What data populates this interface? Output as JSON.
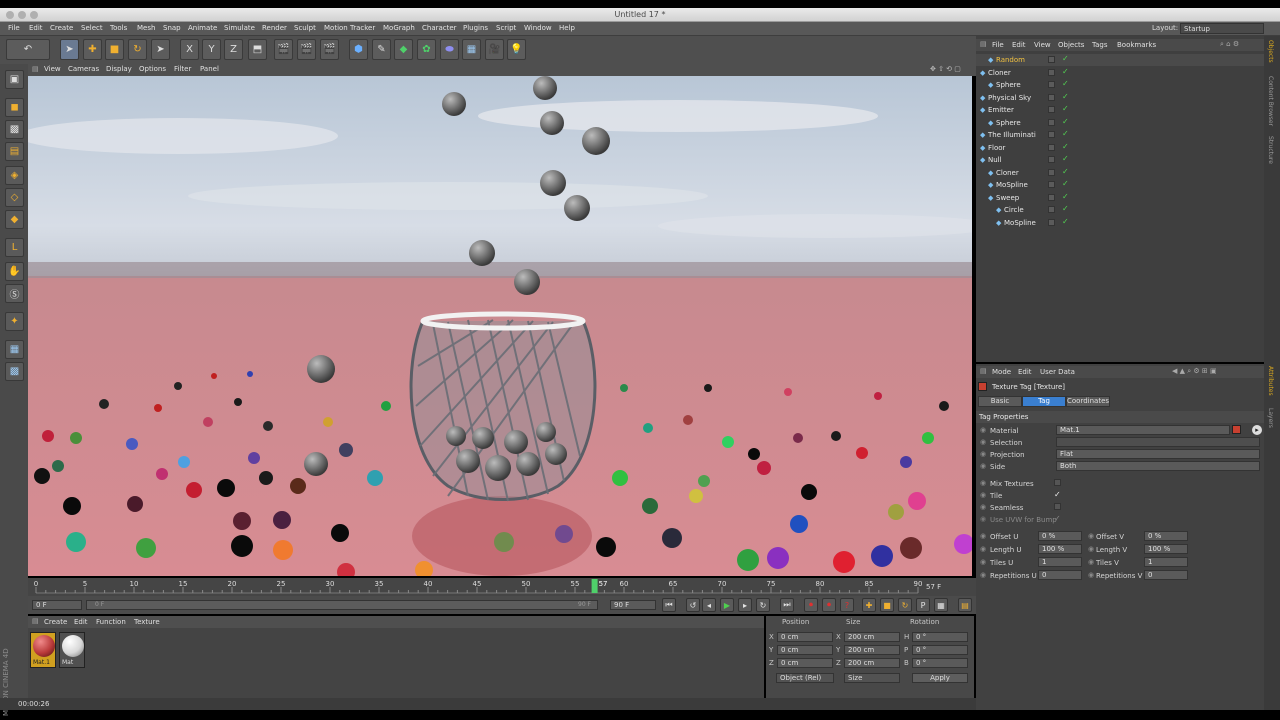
{
  "window": {
    "title": "Untitled 17 *"
  },
  "menubar": {
    "items": [
      "File",
      "Edit",
      "Create",
      "Select",
      "Tools",
      "Mesh",
      "Snap",
      "Animate",
      "Simulate",
      "Render",
      "Sculpt",
      "Motion Tracker",
      "MoGraph",
      "Character",
      "Plugins",
      "Script",
      "Window",
      "Help"
    ],
    "layout_label": "Layout:",
    "layout_value": "Startup"
  },
  "toolbar": {
    "axis_x": "X",
    "axis_y": "Y",
    "axis_z": "Z"
  },
  "viewport": {
    "menu": [
      "View",
      "Cameras",
      "Display",
      "Options",
      "Filter",
      "Panel"
    ]
  },
  "timeline": {
    "ticks": [
      "0",
      "5",
      "10",
      "15",
      "20",
      "25",
      "30",
      "35",
      "40",
      "45",
      "50",
      "55",
      "60",
      "65",
      "70",
      "75",
      "80",
      "85",
      "90"
    ],
    "current_frame": "57",
    "current_frame_label": "57 F",
    "start_field": "0 F",
    "end_field": "90 F",
    "slider_left": "0 F",
    "slider_right": "90 F"
  },
  "material_manager": {
    "menu": [
      "Create",
      "Edit",
      "Function",
      "Texture"
    ],
    "materials": [
      {
        "name": "Mat.1",
        "color": "#b93a3a",
        "selected": true
      },
      {
        "name": "Mat",
        "color": "#e8e8e8",
        "selected": false
      }
    ]
  },
  "coordinates": {
    "headers": [
      "Position",
      "Size",
      "Rotation"
    ],
    "rows": [
      {
        "axis": "X",
        "pos": "0 cm",
        "size_axis": "X",
        "size": "200 cm",
        "rot_axis": "H",
        "rot": "0 °"
      },
      {
        "axis": "Y",
        "pos": "0 cm",
        "size_axis": "Y",
        "size": "200 cm",
        "rot_axis": "P",
        "rot": "0 °"
      },
      {
        "axis": "Z",
        "pos": "0 cm",
        "size_axis": "Z",
        "size": "200 cm",
        "rot_axis": "B",
        "rot": "0 °"
      }
    ],
    "mode_select": "Object (Rel)",
    "size_select": "Size",
    "apply_label": "Apply"
  },
  "status": {
    "time": "00:00:26"
  },
  "object_manager": {
    "menu": [
      "File",
      "Edit",
      "View",
      "Objects",
      "Tags",
      "Bookmarks"
    ],
    "objects": [
      {
        "name": "Random",
        "indent": 1,
        "color": "#f0c040"
      },
      {
        "name": "Cloner",
        "indent": 0,
        "color": "#e8e8e8"
      },
      {
        "name": "Sphere",
        "indent": 1,
        "color": "#e8e8e8"
      },
      {
        "name": "Physical Sky",
        "indent": 0,
        "color": "#e8e8e8"
      },
      {
        "name": "Emitter",
        "indent": 0,
        "color": "#e8e8e8"
      },
      {
        "name": "Sphere",
        "indent": 1,
        "color": "#e8e8e8"
      },
      {
        "name": "The Illuminati",
        "indent": 0,
        "color": "#e8e8e8"
      },
      {
        "name": "Floor",
        "indent": 0,
        "color": "#e8e8e8"
      },
      {
        "name": "Null",
        "indent": 0,
        "color": "#e8e8e8"
      },
      {
        "name": "Cloner",
        "indent": 1,
        "color": "#e8e8e8"
      },
      {
        "name": "MoSpline",
        "indent": 1,
        "color": "#e8e8e8"
      },
      {
        "name": "Sweep",
        "indent": 1,
        "color": "#e8e8e8"
      },
      {
        "name": "Circle",
        "indent": 2,
        "color": "#e8e8e8"
      },
      {
        "name": "MoSpline",
        "indent": 2,
        "color": "#e8e8e8"
      }
    ]
  },
  "attributes": {
    "menu": [
      "Mode",
      "Edit",
      "User Data"
    ],
    "header": "Texture Tag [Texture]",
    "tabs": [
      "Basic",
      "Tag",
      "Coordinates"
    ],
    "active_tab": "Tag",
    "section": "Tag Properties",
    "material_label": "Material",
    "material_value": "Mat.1",
    "selection_label": "Selection",
    "projection_label": "Projection",
    "projection_value": "Flat",
    "side_label": "Side",
    "side_value": "Both",
    "mix_label": "Mix Textures",
    "tile_label": "Tile",
    "seamless_label": "Seamless",
    "uvw_label": "Use UVW for Bump",
    "offset_u_label": "Offset U",
    "offset_u": "0 %",
    "offset_v_label": "Offset V",
    "offset_v": "0 %",
    "length_u_label": "Length U",
    "length_u": "100 %",
    "length_v_label": "Length V",
    "length_v": "100 %",
    "tiles_u_label": "Tiles U",
    "tiles_u": "1",
    "tiles_v_label": "Tiles V",
    "tiles_v": "1",
    "rep_u_label": "Repetitions U",
    "rep_u": "0",
    "rep_v_label": "Repetitions V",
    "rep_v": "0"
  },
  "right_tabs": [
    "Objects",
    "Content Browser",
    "Structure",
    "Attributes",
    "Layers"
  ],
  "branding": "MAXON CINEMA 4D"
}
